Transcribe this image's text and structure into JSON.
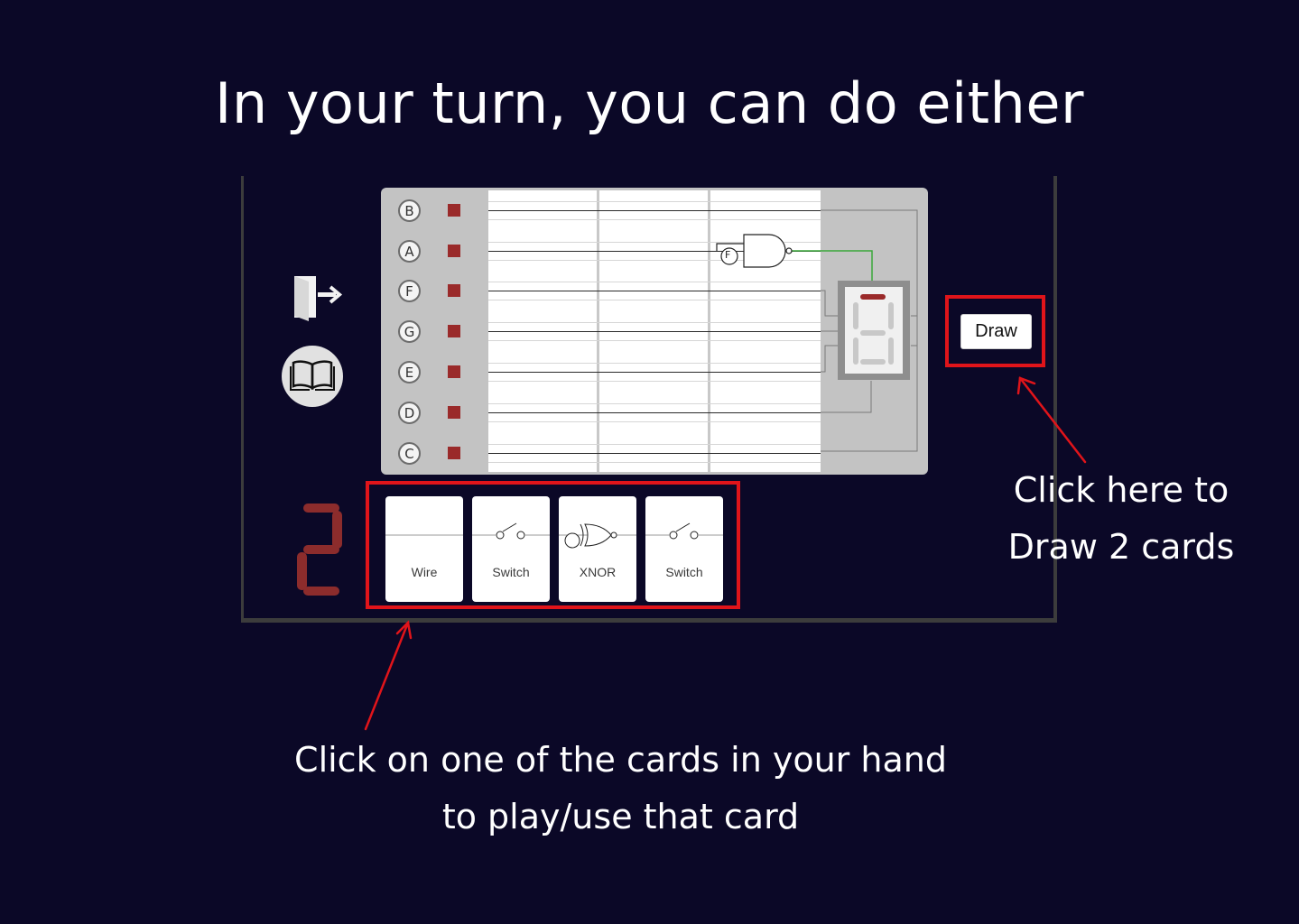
{
  "heading": "In your turn, you can do either",
  "rows": [
    {
      "label": "B"
    },
    {
      "label": "A"
    },
    {
      "label": "F"
    },
    {
      "label": "G"
    },
    {
      "label": "E"
    },
    {
      "label": "D"
    },
    {
      "label": "C"
    }
  ],
  "board": {
    "gate_label": "F",
    "cards_left_display": "2"
  },
  "hand": [
    {
      "label": "Wire",
      "symbol": "wire"
    },
    {
      "label": "Switch",
      "symbol": "switch"
    },
    {
      "label": "XNOR",
      "symbol": "xnor-gate"
    },
    {
      "label": "Switch",
      "symbol": "switch"
    }
  ],
  "buttons": {
    "draw_label": "Draw"
  },
  "icons": {
    "exit": "exit-door-icon",
    "rules": "book-icon"
  },
  "annotations": {
    "draw_line1": "Click here to",
    "draw_line2": "Draw 2 cards",
    "hand_line1": "Click on one of the cards in your hand",
    "hand_line2": "to play/use that card"
  },
  "colors": {
    "background": "#0b0827",
    "highlight": "#e0141a",
    "segment_on": "#8c2c2c",
    "board": "#c3c3c3"
  }
}
